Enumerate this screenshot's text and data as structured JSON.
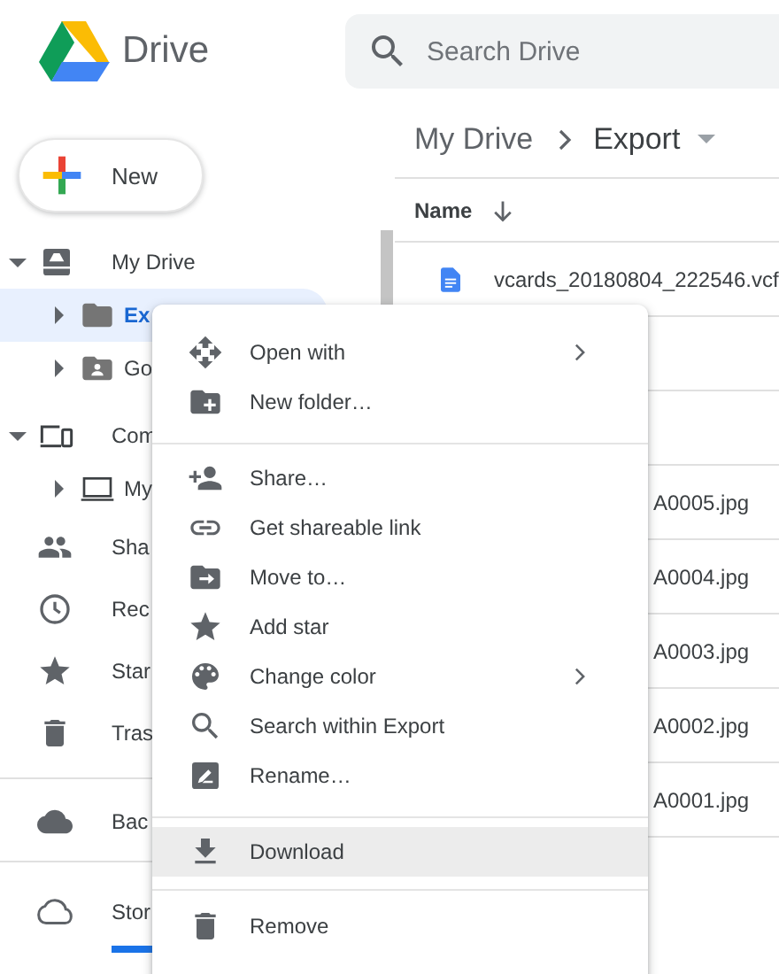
{
  "header": {
    "logo_text": "Drive",
    "search": {
      "placeholder": "Search Drive"
    }
  },
  "new_button": {
    "label": "New"
  },
  "sidebar": {
    "sections": [
      {
        "items": [
          {
            "kind": "tree",
            "label": "My Drive",
            "expanded": true,
            "selected": false,
            "children": [
              {
                "kind": "tree",
                "label": "Ex",
                "expanded": false,
                "selected": true
              },
              {
                "kind": "tree",
                "label": "Go",
                "expanded": false,
                "selected": false
              }
            ]
          },
          {
            "kind": "tree",
            "label": "Com",
            "expanded": true,
            "selected": false,
            "children": [
              {
                "kind": "tree",
                "label": "My",
                "expanded": false,
                "selected": false
              }
            ]
          },
          {
            "kind": "link",
            "label": "Sha",
            "selected": false
          },
          {
            "kind": "link",
            "label": "Rec",
            "selected": false
          },
          {
            "kind": "link",
            "label": "Star",
            "selected": false
          },
          {
            "kind": "link",
            "label": "Tras",
            "selected": false
          }
        ]
      },
      {
        "items": [
          {
            "kind": "link",
            "label": "Bac",
            "selected": false
          }
        ]
      },
      {
        "items": [
          {
            "kind": "storage",
            "label": "Stor",
            "selected": false
          }
        ]
      }
    ]
  },
  "breadcrumb": [
    "My Drive",
    "Export"
  ],
  "file_list": {
    "columns": [
      {
        "label": "Name",
        "sort_descending": true
      }
    ],
    "rows": [
      {
        "kind": "document",
        "name": "vcards_20180804_222546.vcf"
      },
      {
        "kind": "covered"
      },
      {
        "kind": "covered"
      },
      {
        "kind": "partial",
        "name": "A0005.jpg"
      },
      {
        "kind": "partial",
        "name": "A0004.jpg"
      },
      {
        "kind": "partial",
        "name": "A0003.jpg"
      },
      {
        "kind": "partial",
        "name": "A0002.jpg"
      },
      {
        "kind": "partial",
        "name": "A0001.jpg"
      }
    ]
  },
  "context_menu": {
    "groups": [
      [
        {
          "label": "Open with",
          "submenu": true,
          "highlighted": false
        },
        {
          "label": "New folder…",
          "submenu": false,
          "highlighted": false
        }
      ],
      [
        {
          "label": "Share…",
          "submenu": false,
          "highlighted": false
        },
        {
          "label": "Get shareable link",
          "submenu": false,
          "highlighted": false
        },
        {
          "label": "Move to…",
          "submenu": false,
          "highlighted": false
        },
        {
          "label": "Add star",
          "submenu": false,
          "highlighted": false
        },
        {
          "label": "Change color",
          "submenu": true,
          "highlighted": false
        },
        {
          "label": "Search within Export",
          "submenu": false,
          "highlighted": false
        },
        {
          "label": "Rename…",
          "submenu": false,
          "highlighted": false
        }
      ],
      [
        {
          "label": "Download",
          "submenu": false,
          "highlighted": true
        }
      ],
      [
        {
          "label": "Remove",
          "submenu": false,
          "highlighted": false
        }
      ]
    ]
  }
}
